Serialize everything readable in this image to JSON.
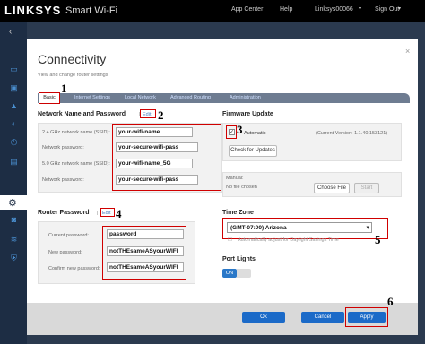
{
  "header": {
    "logo": "LINKSYS",
    "product": "Smart Wi-Fi",
    "nav": [
      "App Center",
      "Help",
      "Linksys00066",
      "Sign Out"
    ]
  },
  "sidebar": {
    "icons": [
      "chevron-left-icon",
      "device-list-icon",
      "parental-controls-icon",
      "alert-icon",
      "speed-icon",
      "clock-icon",
      "media-prioritization-icon",
      "settings-icon",
      "camera-icon",
      "wifi-icon",
      "security-shield-icon"
    ]
  },
  "page": {
    "title": "Connectivity",
    "subtitle": "View and change router settings",
    "close": "×"
  },
  "tabs": [
    "Basic",
    "Internet Settings",
    "Local Network",
    "Advanced Routing",
    "Administration"
  ],
  "network": {
    "heading": "Network Name and Password",
    "edit": "Edit",
    "fields": [
      {
        "label": "2.4 GHz network name (SSID):",
        "value": "your-wifi-name"
      },
      {
        "label": "Network password:",
        "value": "your-secure-wifi-pass"
      },
      {
        "label": "5.0 GHz network name (SSID):",
        "value": "your-wifi-name_5G"
      },
      {
        "label": "Network password:",
        "value": "your-secure-wifi-pass"
      }
    ]
  },
  "router_password": {
    "heading": "Router Password",
    "edit": "Edit",
    "fields": [
      {
        "label": "Current password:",
        "value": "password"
      },
      {
        "label": "New password:",
        "value": "notTHEsameASyourWIFI"
      },
      {
        "label": "Confirm new password:",
        "value": "notTHEsameASyourWIFI"
      }
    ]
  },
  "firmware": {
    "heading": "Firmware Update",
    "automatic": "Automatic",
    "version": "(Current Version: 1.1.40.153121)",
    "check": "Check for Updates",
    "manual": "Manual:",
    "no_file": "No file chosen",
    "choose": "Choose File",
    "start": "Start"
  },
  "timezone": {
    "heading": "Time Zone",
    "value": "(GMT-07:00) Arizona",
    "dst": "Automatically adjust for Daylight Savings Time"
  },
  "port_lights": {
    "heading": "Port Lights",
    "toggle": "ON"
  },
  "footer": {
    "ok": "Ok",
    "cancel": "Cancel",
    "apply": "Apply"
  },
  "callouts": [
    "1",
    "2",
    "3",
    "4",
    "5",
    "6"
  ],
  "colors": {
    "highlight": "#d00000",
    "accent": "#1b6ac8",
    "toggle": "#2a78c8"
  }
}
